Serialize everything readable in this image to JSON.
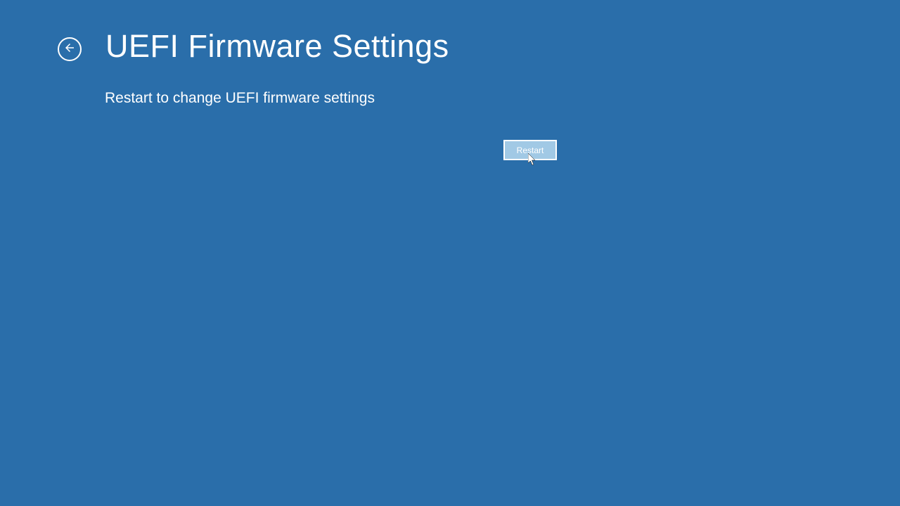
{
  "header": {
    "title": "UEFI Firmware Settings"
  },
  "main": {
    "description": "Restart to change UEFI firmware settings",
    "restart_label": "Restart"
  }
}
